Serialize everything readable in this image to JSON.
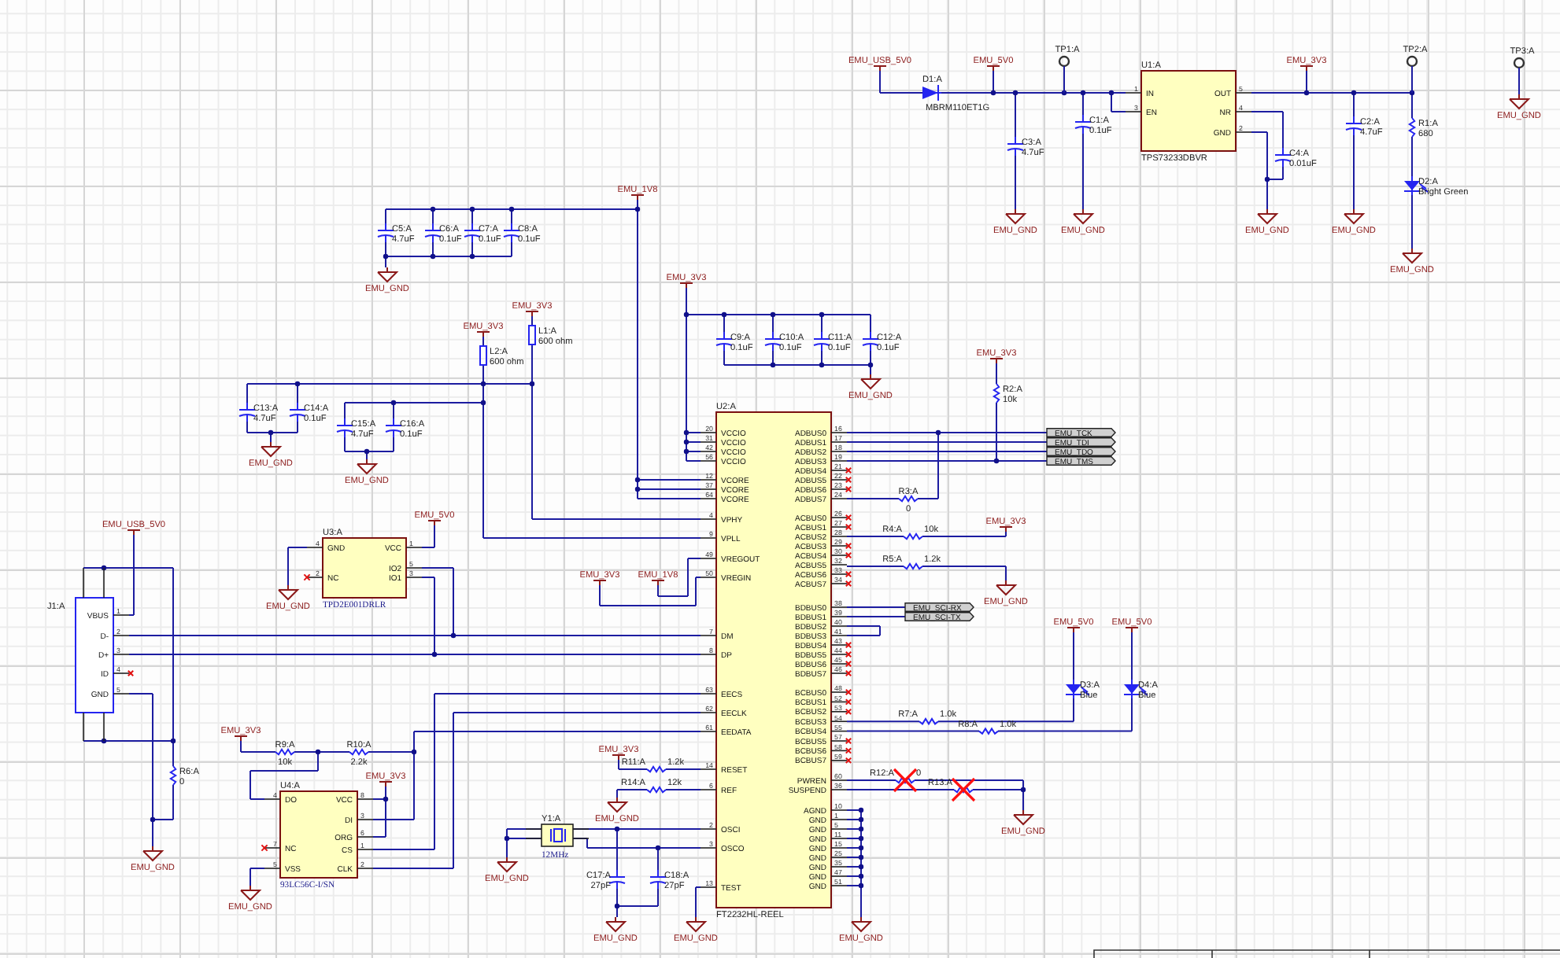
{
  "power_ports": [
    {
      "kind": "power",
      "label": "EMU_USB_5V0"
    },
    {
      "kind": "power",
      "label": "EMU_5V0"
    },
    {
      "kind": "power",
      "label": "EMU_3V3"
    },
    {
      "kind": "ground",
      "label": "EMU_GND"
    },
    {
      "kind": "ground",
      "label": "EMU_GND"
    },
    {
      "kind": "ground",
      "label": "EMU_GND"
    },
    {
      "kind": "ground",
      "label": "EMU_GND"
    },
    {
      "kind": "ground",
      "label": "EMU_GND"
    },
    {
      "kind": "ground",
      "label": "EMU_GND"
    },
    {
      "kind": "power",
      "label": "EMU_1V8"
    },
    {
      "kind": "ground",
      "label": "EMU_GND"
    },
    {
      "kind": "power",
      "label": "EMU_3V3"
    },
    {
      "kind": "power",
      "label": "EMU_3V3"
    },
    {
      "kind": "ground",
      "label": "EMU_GND"
    },
    {
      "kind": "ground",
      "label": "EMU_GND"
    },
    {
      "kind": "power",
      "label": "EMU_3V3"
    },
    {
      "kind": "ground",
      "label": "EMU_GND"
    },
    {
      "kind": "power",
      "label": "EMU_3V3"
    },
    {
      "kind": "power",
      "label": "EMU_3V3"
    },
    {
      "kind": "ground",
      "label": "EMU_GND"
    },
    {
      "kind": "power",
      "label": "EMU_USB_5V0"
    },
    {
      "kind": "power",
      "label": "EMU_5V0"
    },
    {
      "kind": "ground",
      "label": "EMU_GND"
    },
    {
      "kind": "power",
      "label": "EMU_3V3"
    },
    {
      "kind": "power",
      "label": "EMU_1V8"
    },
    {
      "kind": "ground",
      "label": "EMU_GND"
    },
    {
      "kind": "power",
      "label": "EMU_3V3"
    },
    {
      "kind": "power",
      "label": "EMU_3V3"
    },
    {
      "kind": "ground",
      "label": "EMU_GND"
    },
    {
      "kind": "power",
      "label": "EMU_3V3"
    },
    {
      "kind": "ground",
      "label": "EMU_GND"
    },
    {
      "kind": "ground",
      "label": "EMU_GND"
    },
    {
      "kind": "ground",
      "label": "EMU_GND"
    },
    {
      "kind": "ground",
      "label": "EMU_GND"
    },
    {
      "kind": "ground",
      "label": "EMU_GND"
    },
    {
      "kind": "ground",
      "label": "EMU_GND"
    },
    {
      "kind": "power",
      "label": "EMU_5V0"
    },
    {
      "kind": "power",
      "label": "EMU_5V0"
    }
  ],
  "components": [
    {
      "kind": "diode",
      "designator": "D1:A",
      "value": "MBRM110ET1G",
      "crossed_out": false
    },
    {
      "kind": "test_point",
      "designator": "TP1:A",
      "crossed_out": false
    },
    {
      "kind": "capacitor",
      "designator": "C3:A",
      "value": "4.7uF",
      "crossed_out": false
    },
    {
      "kind": "capacitor",
      "designator": "C1:A",
      "value": "0.1uF",
      "crossed_out": false
    },
    {
      "kind": "capacitor",
      "designator": "C4:A",
      "value": "0.01uF",
      "crossed_out": false
    },
    {
      "kind": "test_point",
      "designator": "TP2:A",
      "crossed_out": false
    },
    {
      "kind": "capacitor",
      "designator": "C2:A",
      "value": "4.7uF",
      "crossed_out": false
    },
    {
      "kind": "resistor",
      "designator": "R1:A",
      "value": "680",
      "crossed_out": false
    },
    {
      "kind": "led",
      "designator": "D2:A",
      "value": "Bright Green",
      "crossed_out": false
    },
    {
      "kind": "test_point",
      "designator": "TP3:A",
      "crossed_out": false
    },
    {
      "kind": "capacitor",
      "designator": "C5:A",
      "value": "4.7uF",
      "crossed_out": false
    },
    {
      "kind": "capacitor",
      "designator": "C6:A",
      "value": "0.1uF",
      "crossed_out": false
    },
    {
      "kind": "capacitor",
      "designator": "C7:A",
      "value": "0.1uF",
      "crossed_out": false
    },
    {
      "kind": "capacitor",
      "designator": "C8:A",
      "value": "0.1uF",
      "crossed_out": false
    },
    {
      "kind": "inductor",
      "designator": "L1:A",
      "value": "600 ohm",
      "crossed_out": false
    },
    {
      "kind": "inductor",
      "designator": "L2:A",
      "value": "600 ohm",
      "crossed_out": false
    },
    {
      "kind": "capacitor",
      "designator": "C13:A",
      "value": "4.7uF",
      "crossed_out": false
    },
    {
      "kind": "capacitor",
      "designator": "C14:A",
      "value": "0.1uF",
      "crossed_out": false
    },
    {
      "kind": "capacitor",
      "designator": "C15:A",
      "value": "4.7uF",
      "crossed_out": false
    },
    {
      "kind": "capacitor",
      "designator": "C16:A",
      "value": "0.1uF",
      "crossed_out": false
    },
    {
      "kind": "capacitor",
      "designator": "C9:A",
      "value": "0.1uF",
      "crossed_out": false
    },
    {
      "kind": "capacitor",
      "designator": "C10:A",
      "value": "0.1uF",
      "crossed_out": false
    },
    {
      "kind": "capacitor",
      "designator": "C11:A",
      "value": "0.1uF",
      "crossed_out": false
    },
    {
      "kind": "capacitor",
      "designator": "C12:A",
      "value": "0.1uF",
      "crossed_out": false
    },
    {
      "kind": "resistor",
      "designator": "R2:A",
      "value": "10k",
      "crossed_out": false
    },
    {
      "kind": "resistor",
      "designator": "R3:A",
      "value": "0",
      "crossed_out": false
    },
    {
      "kind": "resistor",
      "designator": "R4:A",
      "value": "10k",
      "crossed_out": false
    },
    {
      "kind": "resistor",
      "designator": "R5:A",
      "value": "1.2k",
      "crossed_out": false
    },
    {
      "kind": "resistor",
      "designator": "R6:A",
      "value": "0",
      "crossed_out": false
    },
    {
      "kind": "resistor",
      "designator": "R9:A",
      "value": "10k",
      "crossed_out": false
    },
    {
      "kind": "resistor",
      "designator": "R10:A",
      "value": "2.2k",
      "crossed_out": false
    },
    {
      "kind": "resistor",
      "designator": "R11:A",
      "value": "1.2k",
      "crossed_out": false
    },
    {
      "kind": "resistor",
      "designator": "R14:A",
      "value": "12k",
      "crossed_out": false
    },
    {
      "kind": "crystal",
      "designator": "Y1:A",
      "value": "12MHz",
      "crossed_out": false
    },
    {
      "kind": "capacitor",
      "designator": "C17:A",
      "value": "27pF",
      "crossed_out": false
    },
    {
      "kind": "capacitor",
      "designator": "C18:A",
      "value": "27pF",
      "crossed_out": false
    },
    {
      "kind": "led",
      "designator": "D3:A",
      "value": "Blue",
      "crossed_out": false
    },
    {
      "kind": "led",
      "designator": "D4:A",
      "value": "Blue",
      "crossed_out": false
    },
    {
      "kind": "resistor",
      "designator": "R7:A",
      "value": "1.0k",
      "crossed_out": false
    },
    {
      "kind": "resistor",
      "designator": "R8:A",
      "value": "1.0k",
      "crossed_out": false
    },
    {
      "kind": "resistor",
      "designator": "R12:A",
      "value": "0",
      "crossed_out": true
    },
    {
      "kind": "resistor",
      "designator": "R13:A",
      "crossed_out": true
    }
  ],
  "chips": [
    {
      "kind": "ic",
      "designator": "U1:A",
      "part": "TPS73233DBVR",
      "left_pins": [
        {
          "number": "1",
          "name": "IN",
          "nc": false
        },
        {
          "number": "3",
          "name": "EN",
          "nc": false
        }
      ],
      "right_pins": [
        {
          "number": "5",
          "name": "OUT",
          "nc": false
        },
        {
          "number": "4",
          "name": "NR",
          "nc": false
        },
        {
          "number": "2",
          "name": "GND",
          "nc": false
        }
      ]
    },
    {
      "kind": "ic",
      "designator": "U2:A",
      "part": "FT2232HL-REEL",
      "left_pins": [
        {
          "number": "20",
          "name": "VCCIO",
          "nc": false
        },
        {
          "number": "31",
          "name": "VCCIO",
          "nc": false
        },
        {
          "number": "42",
          "name": "VCCIO",
          "nc": false
        },
        {
          "number": "56",
          "name": "VCCIO",
          "nc": false
        },
        {
          "number": "12",
          "name": "VCORE",
          "nc": false
        },
        {
          "number": "37",
          "name": "VCORE",
          "nc": false
        },
        {
          "number": "64",
          "name": "VCORE",
          "nc": false
        },
        {
          "number": "4",
          "name": "VPHY",
          "nc": false
        },
        {
          "number": "9",
          "name": "VPLL",
          "nc": false
        },
        {
          "number": "49",
          "name": "VREGOUT",
          "nc": false
        },
        {
          "number": "50",
          "name": "VREGIN",
          "nc": false
        },
        {
          "number": "7",
          "name": "DM",
          "nc": false
        },
        {
          "number": "8",
          "name": "DP",
          "nc": false
        },
        {
          "number": "63",
          "name": "EECS",
          "nc": false
        },
        {
          "number": "62",
          "name": "EECLK",
          "nc": false
        },
        {
          "number": "61",
          "name": "EEDATA",
          "nc": false
        },
        {
          "number": "14",
          "name": "RESET",
          "nc": false
        },
        {
          "number": "6",
          "name": "REF",
          "nc": false
        },
        {
          "number": "2",
          "name": "OSCI",
          "nc": false
        },
        {
          "number": "3",
          "name": "OSCO",
          "nc": false
        },
        {
          "number": "13",
          "name": "TEST",
          "nc": false
        }
      ],
      "right_pins": [
        {
          "number": "16",
          "name": "ADBUS0",
          "nc": false
        },
        {
          "number": "17",
          "name": "ADBUS1",
          "nc": false
        },
        {
          "number": "18",
          "name": "ADBUS2",
          "nc": false
        },
        {
          "number": "19",
          "name": "ADBUS3",
          "nc": false
        },
        {
          "number": "21",
          "name": "ADBUS4",
          "nc": true
        },
        {
          "number": "22",
          "name": "ADBUS5",
          "nc": true
        },
        {
          "number": "23",
          "name": "ADBUS6",
          "nc": true
        },
        {
          "number": "24",
          "name": "ADBUS7",
          "nc": false
        },
        {
          "number": "26",
          "name": "ACBUS0",
          "nc": true
        },
        {
          "number": "27",
          "name": "ACBUS1",
          "nc": true
        },
        {
          "number": "28",
          "name": "ACBUS2",
          "nc": false
        },
        {
          "number": "29",
          "name": "ACBUS3",
          "nc": true
        },
        {
          "number": "30",
          "name": "ACBUS4",
          "nc": true
        },
        {
          "number": "32",
          "name": "ACBUS5",
          "nc": false
        },
        {
          "number": "33",
          "name": "ACBUS6",
          "nc": true
        },
        {
          "number": "34",
          "name": "ACBUS7",
          "nc": true
        },
        {
          "number": "38",
          "name": "BDBUS0",
          "nc": false
        },
        {
          "number": "39",
          "name": "BDBUS1",
          "nc": false
        },
        {
          "number": "40",
          "name": "BDBUS2",
          "nc": false
        },
        {
          "number": "41",
          "name": "BDBUS3",
          "nc": false
        },
        {
          "number": "43",
          "name": "BDBUS4",
          "nc": true
        },
        {
          "number": "44",
          "name": "BDBUS5",
          "nc": true
        },
        {
          "number": "45",
          "name": "BDBUS6",
          "nc": true
        },
        {
          "number": "46",
          "name": "BDBUS7",
          "nc": true
        },
        {
          "number": "48",
          "name": "BCBUS0",
          "nc": true
        },
        {
          "number": "52",
          "name": "BCBUS1",
          "nc": true
        },
        {
          "number": "53",
          "name": "BCBUS2",
          "nc": true
        },
        {
          "number": "54",
          "name": "BCBUS3",
          "nc": false
        },
        {
          "number": "55",
          "name": "BCBUS4",
          "nc": false
        },
        {
          "number": "57",
          "name": "BCBUS5",
          "nc": true
        },
        {
          "number": "58",
          "name": "BCBUS6",
          "nc": true
        },
        {
          "number": "59",
          "name": "BCBUS7",
          "nc": true
        },
        {
          "number": "60",
          "name": "PWREN",
          "nc": false
        },
        {
          "number": "36",
          "name": "SUSPEND",
          "nc": false
        },
        {
          "number": "10",
          "name": "AGND",
          "nc": false
        },
        {
          "number": "1",
          "name": "GND",
          "nc": false
        },
        {
          "number": "5",
          "name": "GND",
          "nc": false
        },
        {
          "number": "11",
          "name": "GND",
          "nc": false
        },
        {
          "number": "15",
          "name": "GND",
          "nc": false
        },
        {
          "number": "25",
          "name": "GND",
          "nc": false
        },
        {
          "number": "35",
          "name": "GND",
          "nc": false
        },
        {
          "number": "47",
          "name": "GND",
          "nc": false
        },
        {
          "number": "51",
          "name": "GND",
          "nc": false
        }
      ]
    },
    {
      "kind": "connector",
      "designator": "J1:A",
      "right_pins": [
        {
          "number": "1",
          "name": "VBUS",
          "nc": false
        },
        {
          "number": "2",
          "name": "D-",
          "nc": false
        },
        {
          "number": "3",
          "name": "D+",
          "nc": false
        },
        {
          "number": "4",
          "name": "ID",
          "nc": true
        },
        {
          "number": "5",
          "name": "GND",
          "nc": false
        }
      ]
    },
    {
      "kind": "ic",
      "designator": "U3:A",
      "part": "TPD2E001DRLR",
      "left_pins": [
        {
          "number": "4",
          "name": "GND",
          "nc": false
        },
        {
          "number": "2",
          "name": "NC",
          "nc": true
        }
      ],
      "right_pins": [
        {
          "number": "1",
          "name": "VCC",
          "nc": false
        },
        {
          "number": "5",
          "name": "IO2",
          "nc": false
        },
        {
          "number": "3",
          "name": "IO1",
          "nc": false
        }
      ]
    },
    {
      "kind": "ic",
      "designator": "U4:A",
      "part": "93LC56C-I/SN",
      "left_pins": [
        {
          "number": "4",
          "name": "DO",
          "nc": false
        },
        {
          "number": "7",
          "name": "NC",
          "nc": true
        },
        {
          "number": "5",
          "name": "VSS",
          "nc": false
        }
      ],
      "right_pins": [
        {
          "number": "8",
          "name": "VCC",
          "nc": false
        },
        {
          "number": "3",
          "name": "DI",
          "nc": false
        },
        {
          "number": "6",
          "name": "ORG",
          "nc": false
        },
        {
          "number": "1",
          "name": "CS",
          "nc": false
        },
        {
          "number": "2",
          "name": "CLK",
          "nc": false
        }
      ]
    }
  ],
  "net_flags": [
    {
      "label": "EMU_TCK"
    },
    {
      "label": "EMU_TDI"
    },
    {
      "label": "EMU_TDO"
    },
    {
      "label": "EMU_TMS"
    },
    {
      "label": "EMU_SCI-RX"
    },
    {
      "label": "EMU_SCI-TX"
    }
  ]
}
